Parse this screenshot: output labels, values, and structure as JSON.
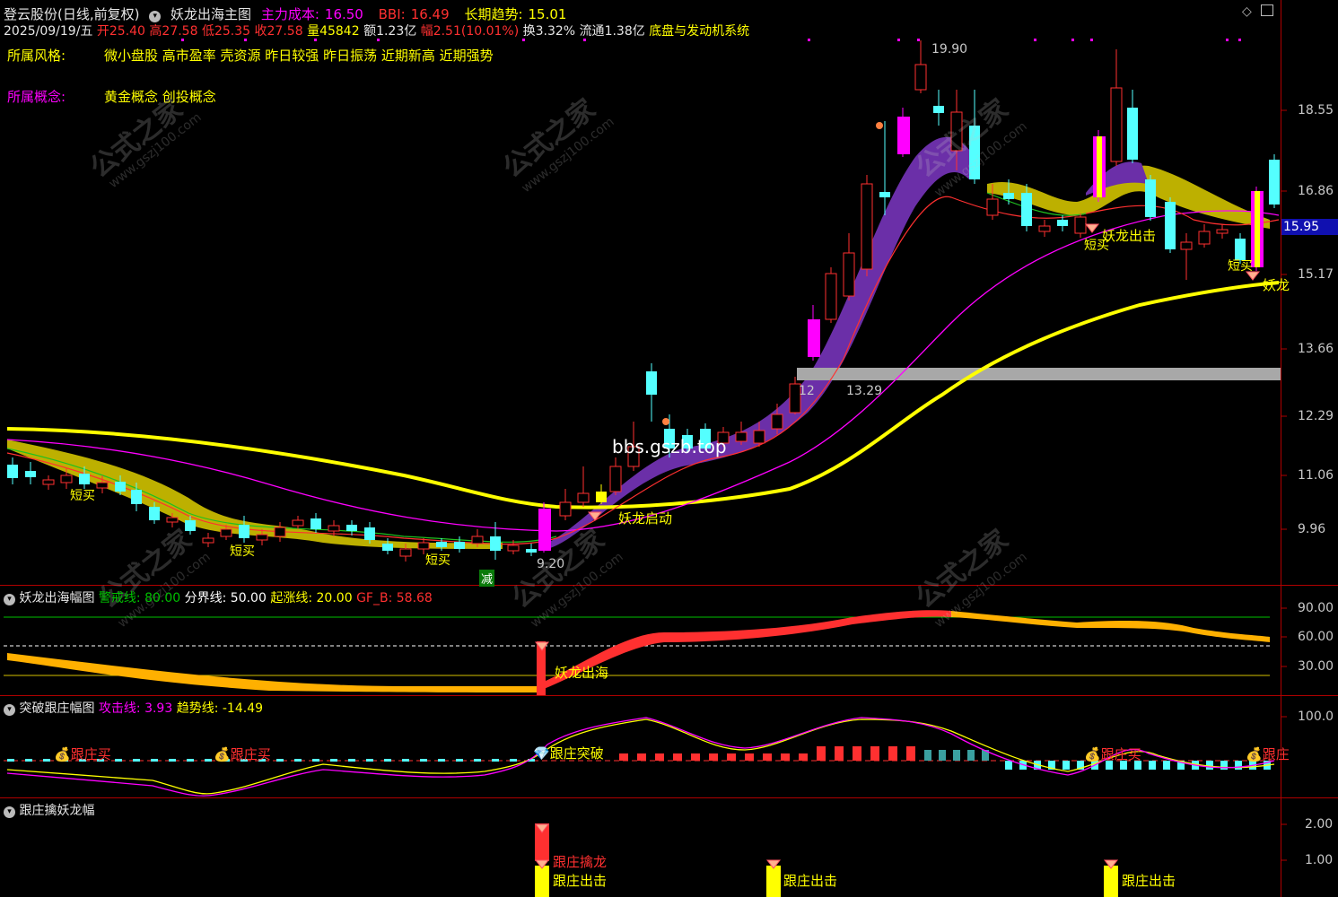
{
  "header": {
    "stock_name": "登云股份(日线,前复权)",
    "formula_name": "妖龙出海主图",
    "indicators": [
      {
        "label": "主力成本:",
        "value": "16.50",
        "color": "#ff00ff"
      },
      {
        "label": "BBI:",
        "value": "16.49",
        "color": "#ff3030"
      },
      {
        "label": "长期趋势:",
        "value": "15.01",
        "color": "#ffff00"
      }
    ],
    "quote": {
      "date": "2025/09/19/五",
      "open_label": "开",
      "open": "25.40",
      "high_label": "高",
      "high": "27.58",
      "low_label": "低",
      "low": "25.35",
      "close_label": "收",
      "close": "27.58",
      "volume_label": "量",
      "volume": "45842",
      "amount_label": "额",
      "amount": "1.23亿",
      "change_label": "幅",
      "change": "2.51(10.01%)",
      "turnover_label": "换",
      "turnover": "3.32%",
      "float_label": "流通",
      "float": "1.38亿",
      "system": "底盘与发动机系统"
    },
    "style_label": "所属风格:",
    "style_value": "微小盘股 高市盈率 壳资源 昨日较强 昨日振荡 近期新高 近期强势",
    "concept_label": "所属概念:",
    "concept_value": "黄金概念 创投概念"
  },
  "main_panel": {
    "price_axis": [
      "18.55",
      "16.86",
      "15.17",
      "13.66",
      "12.29",
      "11.06",
      "9.96"
    ],
    "current_price": "15.95",
    "annotations": {
      "peak": "19.90",
      "low": "9.20",
      "support_left": "12",
      "support": "13.29",
      "short_buy": "短买",
      "dragon_start": "妖龙启动",
      "dragon_strike": "妖龙出击",
      "dragon_edge": "妖龙",
      "reduce": "减",
      "watermark_url": "bbs.gszb.top",
      "watermark_cn": "公式之家",
      "watermark_site": "www.gszj100.com"
    }
  },
  "panel2": {
    "title": "妖龙出海幅图",
    "lines": [
      {
        "label": "警戒线:",
        "value": "80.00",
        "color": "#00c000"
      },
      {
        "label": "分界线:",
        "value": "50.00",
        "color": "#ffffff"
      },
      {
        "label": "起涨线:",
        "value": "20.00",
        "color": "#ffff00"
      },
      {
        "label": "GF_B:",
        "value": "58.68",
        "color": "#ff3030"
      }
    ],
    "axis": [
      "90.00",
      "60.00",
      "30.00"
    ],
    "signal": "妖龙出海"
  },
  "panel3": {
    "title": "突破跟庄幅图",
    "lines": [
      {
        "label": "攻击线:",
        "value": "3.93",
        "color": "#ff00ff"
      },
      {
        "label": "趋势线:",
        "value": "-14.49",
        "color": "#ffff00"
      }
    ],
    "axis": [
      "100.0"
    ],
    "signals": {
      "follow_buy": "跟庄买",
      "follow_break": "跟庄突破",
      "follow_edge": "跟庄"
    }
  },
  "panel4": {
    "title": "跟庄擒妖龙幅",
    "axis": [
      "2.00",
      "1.00"
    ],
    "signals": {
      "capture": "跟庄擒龙",
      "strike": "跟庄出击"
    }
  }
}
